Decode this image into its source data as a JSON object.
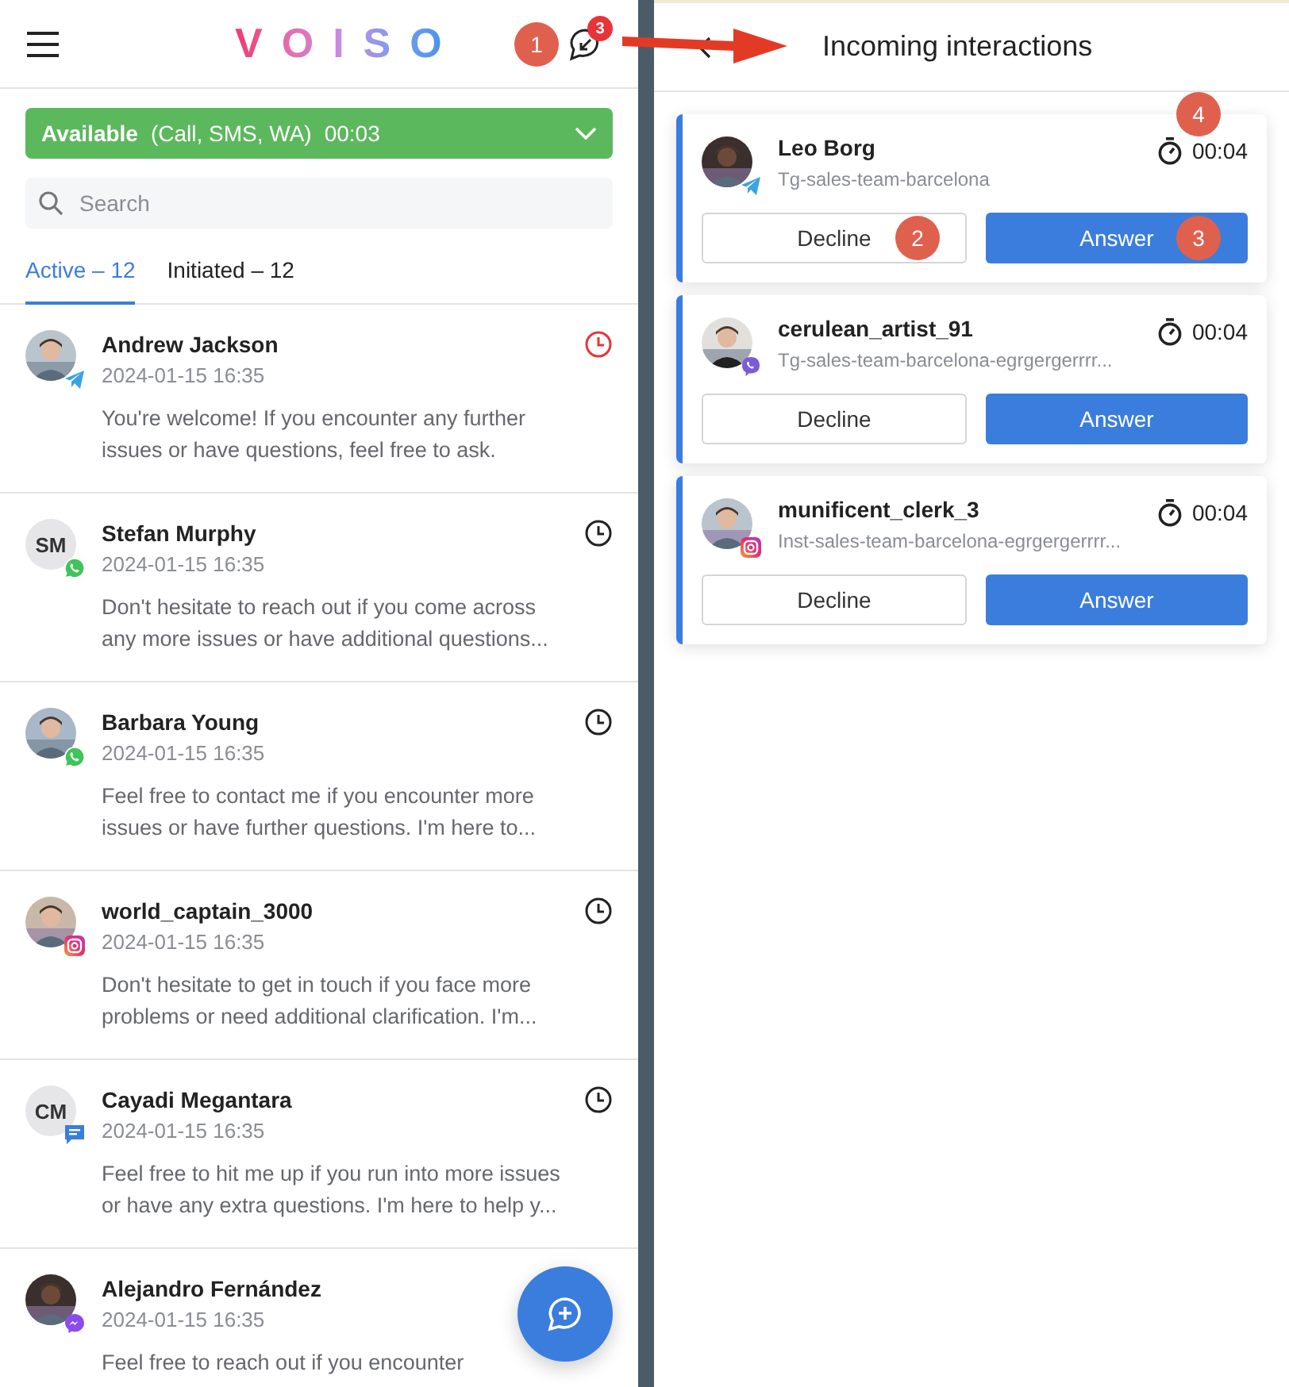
{
  "header": {
    "logo": "VOISO",
    "notification_count": "3"
  },
  "status": {
    "label": "Available",
    "channels": "(Call, SMS, WA)",
    "timer": "00:03"
  },
  "search": {
    "placeholder": "Search"
  },
  "tabs": [
    {
      "label": "Active – 12",
      "selected": true
    },
    {
      "label": "Initiated – 12",
      "selected": false
    }
  ],
  "conversations": [
    {
      "name": "Andrew Jackson",
      "time": "2024-01-15 16:35",
      "message": "You're welcome! If you encounter any further issues or have questions, feel free to ask.",
      "channel": {
        "kind": "telegram"
      },
      "overdue": true
    },
    {
      "name": "Stefan Murphy",
      "time": "2024-01-15 16:35",
      "message": "Don't hesitate to reach out if you come across any more issues or have additional questions...",
      "avatar": {
        "kind": "initials",
        "text": "SM"
      },
      "channel": {
        "kind": "whatsapp"
      },
      "overdue": false
    },
    {
      "name": "Barbara Young",
      "time": "2024-01-15 16:35",
      "message": "Feel free to contact me if you encounter more issues or have further questions. I'm here to...",
      "channel": {
        "kind": "whatsapp"
      },
      "overdue": false
    },
    {
      "name": "world_captain_3000",
      "time": "2024-01-15 16:35",
      "message": "Don't hesitate to get in touch if you face more problems or need additional clarification. I'm...",
      "channel": {
        "kind": "instagram"
      },
      "overdue": false
    },
    {
      "name": "Cayadi Megantara",
      "time": "2024-01-15 16:35",
      "message": "Feel free to hit me up if you run into more issues or have any extra questions. I'm here to help y...",
      "avatar": {
        "kind": "initials",
        "text": "CM"
      },
      "channel": {
        "kind": "sms"
      },
      "overdue": false
    },
    {
      "name": "Alejandro Fernández",
      "time": "2024-01-15 16:35",
      "message": "Feel free to reach out if you encounter",
      "channel": {
        "kind": "messenger"
      }
    }
  ],
  "incoming": {
    "title": "Incoming interactions",
    "items": [
      {
        "name": "Leo Borg",
        "team": "Tg-sales-team-barcelona",
        "timer": "00:04",
        "channel": {
          "kind": "telegram"
        },
        "decline": "Decline",
        "answer": "Answer"
      },
      {
        "name": "cerulean_artist_91",
        "team": "Tg-sales-team-barcelona-egrgergerrrr...",
        "timer": "00:04",
        "channel": {
          "kind": "viber"
        },
        "decline": "Decline",
        "answer": "Answer"
      },
      {
        "name": "munificent_clerk_3",
        "team": "Inst-sales-team-barcelona-egrgergerrrr...",
        "timer": "00:04",
        "channel": {
          "kind": "instagram"
        },
        "decline": "Decline",
        "answer": "Answer"
      }
    ]
  },
  "annotations": [
    {
      "label": "1"
    },
    {
      "label": "2"
    },
    {
      "label": "3"
    },
    {
      "label": "4"
    }
  ]
}
